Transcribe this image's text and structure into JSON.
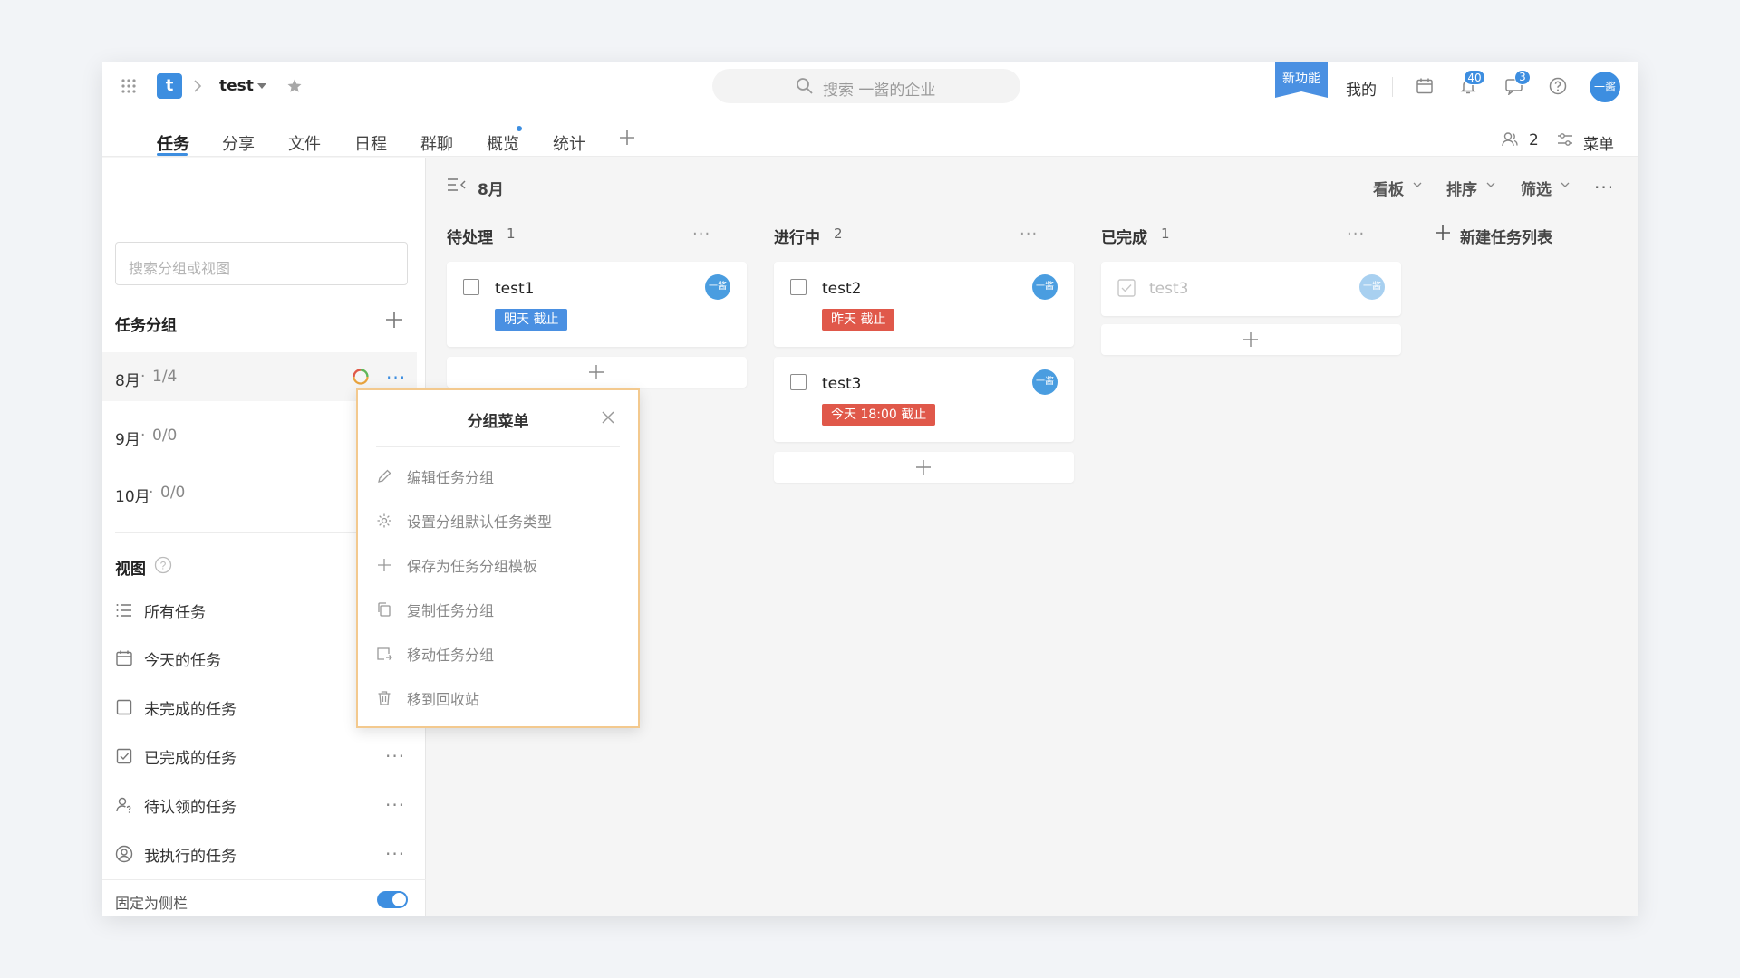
{
  "topbar": {
    "project_icon_letter": "t",
    "project_name": "test",
    "search_placeholder": "搜索 一酱的企业",
    "new_feature_label": "新功能",
    "mine_label": "我的",
    "notification_count": "40",
    "message_count": "3",
    "avatar_text": "一酱"
  },
  "tabs": [
    "任务",
    "分享",
    "文件",
    "日程",
    "群聊",
    "概览",
    "统计"
  ],
  "tabbar_right": {
    "members_count": "2",
    "menu_label": "菜单"
  },
  "sidebar": {
    "search_placeholder": "搜索分组或视图",
    "groups_title": "任务分组",
    "groups": [
      {
        "name": "8月",
        "progress": "1/4"
      },
      {
        "name": "9月",
        "progress": "0/0"
      },
      {
        "name": "10月",
        "progress": "0/0"
      }
    ],
    "views_title": "视图",
    "views": [
      "所有任务",
      "今天的任务",
      "未完成的任务",
      "已完成的任务",
      "待认领的任务",
      "我执行的任务"
    ],
    "pin_label": "固定为侧栏",
    "pin_enabled": true
  },
  "group_menu": {
    "title": "分组菜单",
    "items": [
      "编辑任务分组",
      "设置分组默认任务类型",
      "保存为任务分组模板",
      "复制任务分组",
      "移动任务分组",
      "移到回收站"
    ]
  },
  "board": {
    "current_group": "8月",
    "toolbar": {
      "board_label": "看板",
      "sort_label": "排序",
      "filter_label": "筛选"
    },
    "new_list_label": "新建任务列表",
    "columns": [
      {
        "title": "待处理",
        "count": "1",
        "cards": [
          {
            "name": "test1",
            "tag": "明天 截止",
            "tag_color": "#4a90e2",
            "done": false
          }
        ]
      },
      {
        "title": "进行中",
        "count": "2",
        "cards": [
          {
            "name": "test2",
            "tag": "昨天 截止",
            "tag_color": "#e0584a",
            "done": false
          },
          {
            "name": "test3",
            "tag": "今天 18:00 截止",
            "tag_color": "#e0584a",
            "done": false
          }
        ]
      },
      {
        "title": "已完成",
        "count": "1",
        "cards": [
          {
            "name": "test3",
            "tag": "",
            "done": true
          }
        ]
      }
    ]
  },
  "colors": {
    "accent": "#4a9de0",
    "overdue": "#e0584a",
    "due_soon": "#4a90e2",
    "menu_border": "#f3c98e"
  }
}
